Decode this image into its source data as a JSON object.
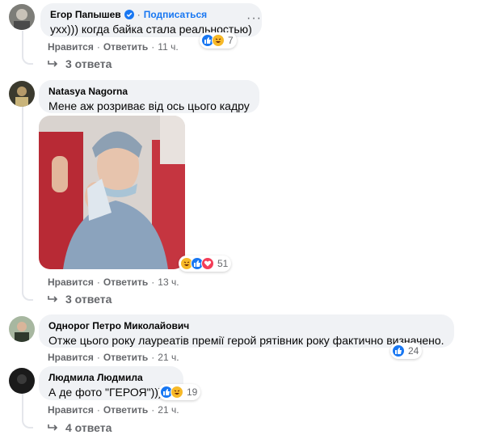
{
  "colors": {
    "bubble": "#f0f2f5",
    "secondary_text": "#65676b",
    "link_blue": "#1877f2",
    "like_blue": "#1877f2",
    "haha_yellow": "#f7b928",
    "love_red": "#f33e58"
  },
  "comments": [
    {
      "author": "Егор Папышев",
      "verified_icon": "verified-badge-icon",
      "follow_label": "Подписаться",
      "text": "ухх))) когда байка стала реальностью)",
      "like": "Нравится",
      "reply": "Ответить",
      "time": "11 ч.",
      "reactions": [
        "like",
        "haha"
      ],
      "reaction_count": "7",
      "replies": "3 ответа",
      "more_icon": "more-dots-icon"
    },
    {
      "author": "Natasya Nagorna",
      "text": "Мене аж розриває від ось цього кадру",
      "has_photo": true,
      "like": "Нравится",
      "reply": "Ответить",
      "time": "13 ч.",
      "reactions": [
        "haha",
        "like",
        "love"
      ],
      "reaction_count": "51",
      "replies": "3 ответа"
    },
    {
      "author": "Однорог Петро Миколайович",
      "text": "Отже цього року лауреатів премії герой рятівник року фактично визначено.",
      "like": "Нравится",
      "reply": "Ответить",
      "time": "21 ч.",
      "reactions": [
        "like"
      ],
      "reaction_count": "24"
    },
    {
      "author": "Людмила Людмила",
      "text": "А де фото \"ГЕРОЯ\"))))))",
      "like": "Нравится",
      "reply": "Ответить",
      "time": "21 ч.",
      "reactions": [
        "like",
        "haha"
      ],
      "reaction_count": "19",
      "replies": "4 ответа"
    }
  ]
}
